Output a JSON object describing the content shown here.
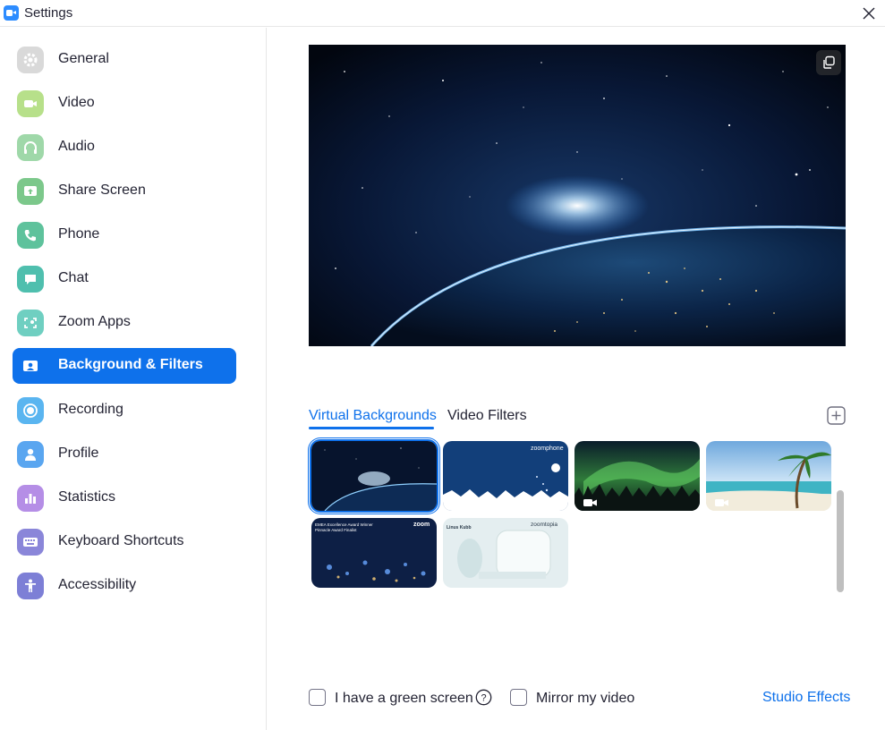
{
  "window": {
    "title": "Settings",
    "app_icon": "zoom-video-icon",
    "close_icon": "close-icon"
  },
  "sidebar": {
    "items": [
      {
        "label": "General",
        "icon": "gear-icon",
        "color": "#d9d9d9"
      },
      {
        "label": "Video",
        "icon": "video-camera-icon",
        "color": "#b7e08a"
      },
      {
        "label": "Audio",
        "icon": "headphones-icon",
        "color": "#9fd8a9"
      },
      {
        "label": "Share Screen",
        "icon": "share-screen-icon",
        "color": "#7cc88b"
      },
      {
        "label": "Phone",
        "icon": "phone-icon",
        "color": "#5ec29c"
      },
      {
        "label": "Chat",
        "icon": "chat-bubble-icon",
        "color": "#4fbfae"
      },
      {
        "label": "Zoom Apps",
        "icon": "zoom-apps-icon",
        "color": "#6fcfc1"
      },
      {
        "label": "Background & Filters",
        "icon": "background-icon",
        "color": "#ffffff",
        "active": true
      },
      {
        "label": "Recording",
        "icon": "record-icon",
        "color": "#5ab5f0"
      },
      {
        "label": "Profile",
        "icon": "person-icon",
        "color": "#5aa6f0"
      },
      {
        "label": "Statistics",
        "icon": "bar-chart-icon",
        "color": "#b58ee6"
      },
      {
        "label": "Keyboard Shortcuts",
        "icon": "keyboard-icon",
        "color": "#8a86d9"
      },
      {
        "label": "Accessibility",
        "icon": "accessibility-icon",
        "color": "#7d7fd6"
      }
    ]
  },
  "preview": {
    "description_icon": "picture-in-picture-icon"
  },
  "tabs": [
    {
      "label": "Virtual Backgrounds",
      "active": true
    },
    {
      "label": "Video Filters",
      "active": false
    }
  ],
  "add_background_icon": "plus-icon",
  "thumbnails": [
    {
      "name": "earth-from-space",
      "selected": true,
      "has_video_badge": false
    },
    {
      "name": "zoomphone-winter",
      "overlay_text": "zoomphone",
      "has_video_badge": false
    },
    {
      "name": "northern-lights",
      "has_video_badge": true
    },
    {
      "name": "tropical-beach",
      "has_video_badge": true
    },
    {
      "name": "emea-award",
      "overlay_text": "zoom",
      "caption_lines": [
        "EMEA Excellence Award Winner",
        "Pinnacle Award Finalist"
      ],
      "has_video_badge": false
    },
    {
      "name": "zoomtopia-partner",
      "overlay_text": "zoomtopia",
      "caption_lines": [
        "Linus Kubb"
      ],
      "has_video_badge": false
    }
  ],
  "footer": {
    "green_screen_label": "I have a green screen",
    "green_screen_checked": false,
    "mirror_label": "Mirror my video",
    "mirror_checked": false,
    "studio_effects_label": "Studio Effects"
  },
  "colors": {
    "accent": "#0E71EB",
    "text": "#232333"
  }
}
